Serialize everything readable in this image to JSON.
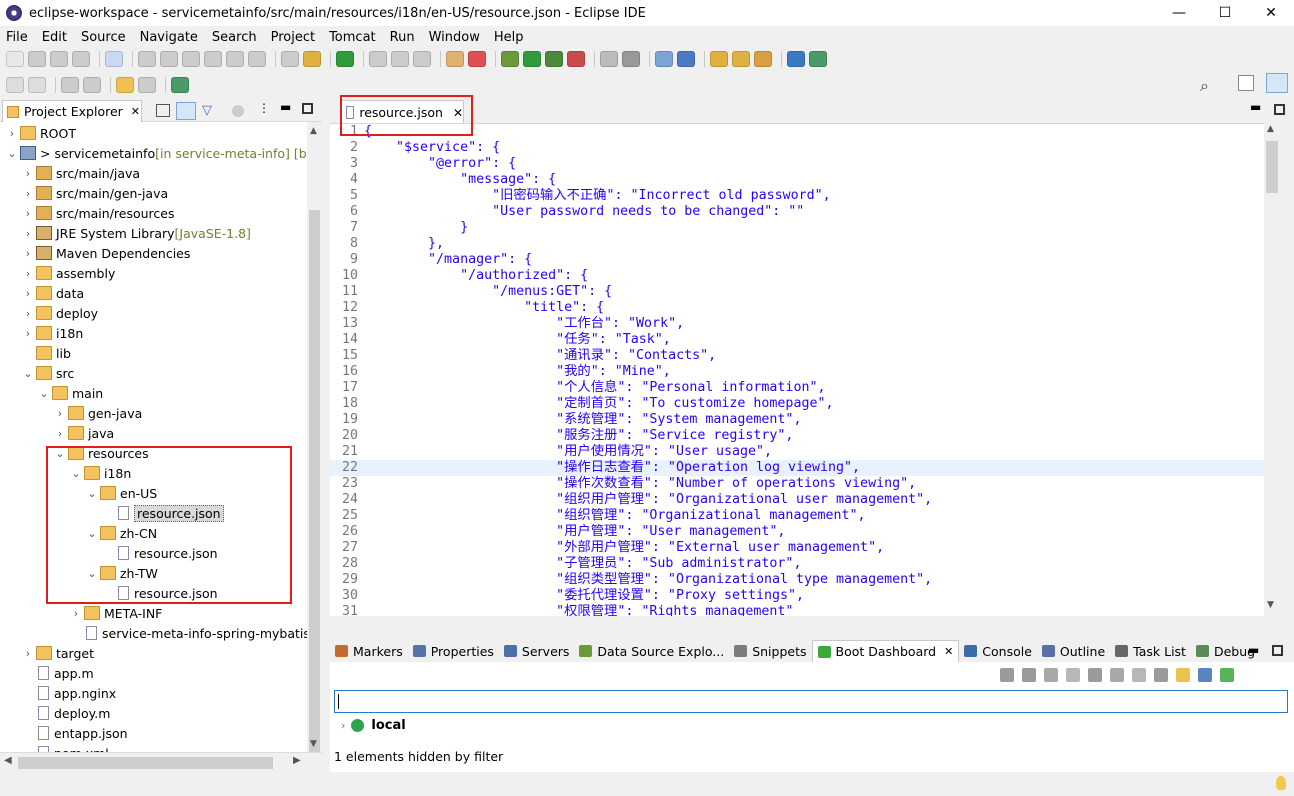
{
  "window": {
    "title": "eclipse-workspace - servicemetainfo/src/main/resources/i18n/en-US/resource.json - Eclipse IDE",
    "minimize": "—",
    "maximize": "☐",
    "close": "✕"
  },
  "menu": [
    "File",
    "Edit",
    "Source",
    "Navigate",
    "Search",
    "Project",
    "Tomcat",
    "Run",
    "Window",
    "Help"
  ],
  "explorer": {
    "tab_label": "Project Explorer",
    "items": [
      {
        "label": "ROOT",
        "indent": 0,
        "tw": "›",
        "icon": "folder"
      },
      {
        "label": "> servicemetainfo",
        "suffix": " [in service-meta-info] [boot]",
        "indent": 0,
        "tw": "⌄",
        "icon": "project"
      },
      {
        "label": "src/main/java",
        "indent": 1,
        "tw": "›",
        "icon": "pkg"
      },
      {
        "label": "src/main/gen-java",
        "indent": 1,
        "tw": "›",
        "icon": "pkg"
      },
      {
        "label": "src/main/resources",
        "indent": 1,
        "tw": "›",
        "icon": "pkg"
      },
      {
        "label": "JRE System Library",
        "suffix": " [JavaSE-1.8]",
        "indent": 1,
        "tw": "›",
        "icon": "jar"
      },
      {
        "label": "Maven Dependencies",
        "indent": 1,
        "tw": "›",
        "icon": "jar"
      },
      {
        "label": "assembly",
        "indent": 1,
        "tw": "›",
        "icon": "folder"
      },
      {
        "label": "data",
        "indent": 1,
        "tw": "›",
        "icon": "folder"
      },
      {
        "label": "deploy",
        "indent": 1,
        "tw": "›",
        "icon": "folder"
      },
      {
        "label": "i18n",
        "indent": 1,
        "tw": "›",
        "icon": "folder"
      },
      {
        "label": "lib",
        "indent": 1,
        "tw": "",
        "icon": "folder"
      },
      {
        "label": "src",
        "indent": 1,
        "tw": "⌄",
        "icon": "folder"
      },
      {
        "label": "main",
        "indent": 2,
        "tw": "⌄",
        "icon": "folder"
      },
      {
        "label": "gen-java",
        "indent": 3,
        "tw": "›",
        "icon": "folder"
      },
      {
        "label": "java",
        "indent": 3,
        "tw": "›",
        "icon": "folder"
      },
      {
        "label": "resources",
        "indent": 3,
        "tw": "⌄",
        "icon": "folder"
      },
      {
        "label": "i18n",
        "indent": 4,
        "tw": "⌄",
        "icon": "folder"
      },
      {
        "label": "en-US",
        "indent": 5,
        "tw": "⌄",
        "icon": "folder"
      },
      {
        "label": "resource.json",
        "indent": 6,
        "tw": "",
        "icon": "file",
        "selected": true
      },
      {
        "label": "zh-CN",
        "indent": 5,
        "tw": "⌄",
        "icon": "folder"
      },
      {
        "label": "resource.json",
        "indent": 6,
        "tw": "",
        "icon": "file"
      },
      {
        "label": "zh-TW",
        "indent": 5,
        "tw": "⌄",
        "icon": "folder"
      },
      {
        "label": "resource.json",
        "indent": 6,
        "tw": "",
        "icon": "file"
      },
      {
        "label": "META-INF",
        "indent": 4,
        "tw": "›",
        "icon": "folder"
      },
      {
        "label": "service-meta-info-spring-mybatis.xml",
        "indent": 4,
        "tw": "",
        "icon": "xml"
      },
      {
        "label": "target",
        "indent": 1,
        "tw": "›",
        "icon": "folder"
      },
      {
        "label": "app.m",
        "indent": 1,
        "tw": "",
        "icon": "file"
      },
      {
        "label": "app.nginx",
        "indent": 1,
        "tw": "",
        "icon": "file"
      },
      {
        "label": "deploy.m",
        "indent": 1,
        "tw": "",
        "icon": "file"
      },
      {
        "label": "entapp.json",
        "indent": 1,
        "tw": "",
        "icon": "file"
      },
      {
        "label": "pom.xml",
        "indent": 1,
        "tw": "",
        "icon": "xml"
      }
    ]
  },
  "editor": {
    "tab_label": "resource.json",
    "highlight_line": 22,
    "lines": [
      "{",
      "    \"$service\": {",
      "        \"@error\": {",
      "            \"message\": {",
      "                \"旧密码输入不正确\": \"Incorrect old password\",",
      "                \"User password needs to be changed\": \"\"",
      "            }",
      "        },",
      "        \"/manager\": {",
      "            \"/authorized\": {",
      "                \"/menus:GET\": {",
      "                    \"title\": {",
      "                        \"工作台\": \"Work\",",
      "                        \"任务\": \"Task\",",
      "                        \"通讯录\": \"Contacts\",",
      "                        \"我的\": \"Mine\",",
      "                        \"个人信息\": \"Personal information\",",
      "                        \"定制首页\": \"To customize homepage\",",
      "                        \"系统管理\": \"System management\",",
      "                        \"服务注册\": \"Service registry\",",
      "                        \"用户使用情况\": \"User usage\",",
      "                        \"操作日志查看\": \"Operation log viewing\",",
      "                        \"操作次数查看\": \"Number of operations viewing\",",
      "                        \"组织用户管理\": \"Organizational user management\",",
      "                        \"组织管理\": \"Organizational management\",",
      "                        \"用户管理\": \"User management\",",
      "                        \"外部用户管理\": \"External user management\",",
      "                        \"子管理员\": \"Sub administrator\",",
      "                        \"组织类型管理\": \"Organizational type management\",",
      "                        \"委托代理设置\": \"Proxy settings\",",
      "                        \"权限管理\": \"Rights management\""
    ]
  },
  "bottom": {
    "tabs": [
      {
        "label": "Markers",
        "color": "#c46a2f"
      },
      {
        "label": "Properties",
        "color": "#5774a8"
      },
      {
        "label": "Servers",
        "color": "#4c6fa5"
      },
      {
        "label": "Data Source Explo...",
        "color": "#6c9a3a"
      },
      {
        "label": "Snippets",
        "color": "#7c7c7c"
      },
      {
        "label": "Boot Dashboard",
        "color": "#3aa83a",
        "active": true
      },
      {
        "label": "Console",
        "color": "#3b6ea8"
      },
      {
        "label": "Outline",
        "color": "#5a6fa8"
      },
      {
        "label": "Task List",
        "color": "#666"
      },
      {
        "label": "Debug",
        "color": "#5c8a5c"
      }
    ],
    "local_label": "local",
    "hidden_text": "1 elements hidden by filter"
  }
}
